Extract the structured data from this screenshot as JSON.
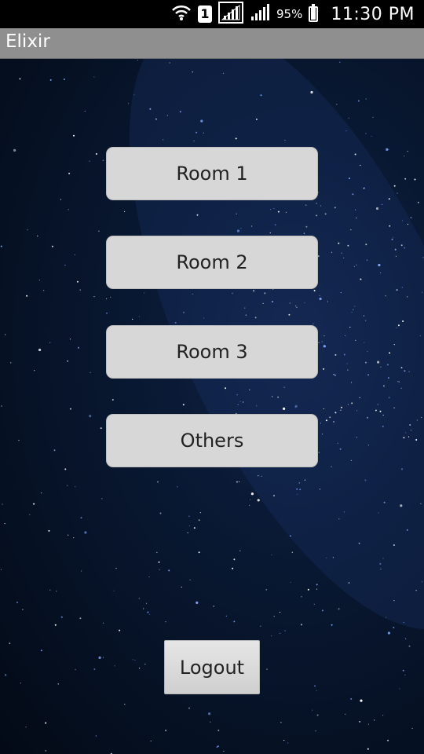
{
  "status_bar": {
    "battery_percent": "95%",
    "battery_level": 0.95,
    "time": "11:30 PM",
    "sim_label": "1",
    "icons": [
      "wifi-icon",
      "sim-icon",
      "signal-icon",
      "signal-icon",
      "battery-icon"
    ]
  },
  "action_bar": {
    "title": "Elixir",
    "background": "#8f8f8f"
  },
  "rooms": [
    {
      "label": "Room 1"
    },
    {
      "label": "Room 2"
    },
    {
      "label": "Room 3"
    },
    {
      "label": "Others"
    }
  ],
  "logout": {
    "label": "Logout"
  },
  "colors": {
    "button_bg": "#d7d7d7",
    "background": "#061226"
  }
}
